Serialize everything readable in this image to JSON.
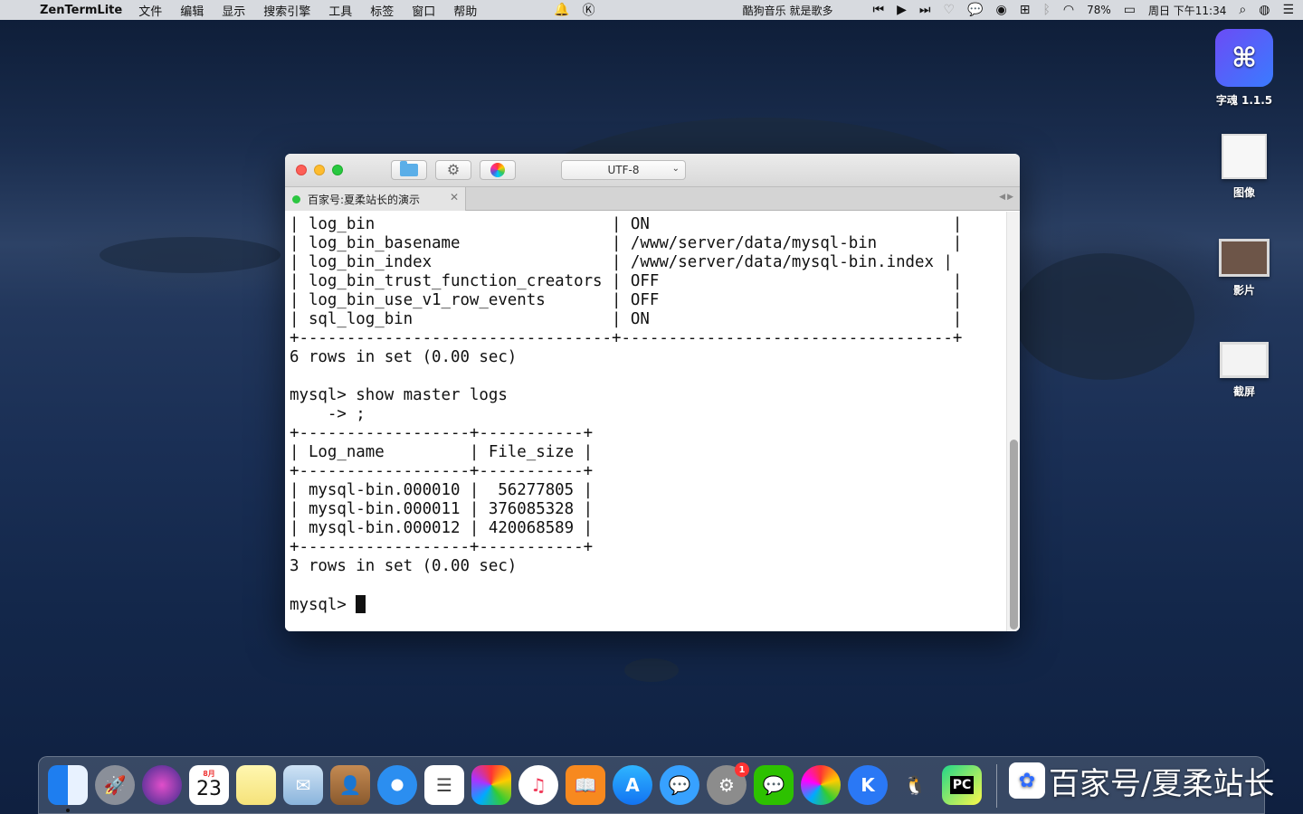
{
  "menubar": {
    "app_name": "ZenTermLite",
    "items": [
      "文件",
      "编辑",
      "显示",
      "搜索引擎",
      "工具",
      "标签",
      "窗口",
      "帮助"
    ],
    "song": "酷狗音乐  就是歌多",
    "battery": "78%",
    "datetime": "周日 下午11:34"
  },
  "window": {
    "encoding": "UTF-8",
    "tab_title": "百家号:夏柔站长的演示",
    "terminal_lines": [
      "| log_bin                         | ON                                |",
      "| log_bin_basename                | /www/server/data/mysql-bin        |",
      "| log_bin_index                   | /www/server/data/mysql-bin.index |",
      "| log_bin_trust_function_creators | OFF                               |",
      "| log_bin_use_v1_row_events       | OFF                               |",
      "| sql_log_bin                     | ON                                |",
      "+---------------------------------+-----------------------------------+",
      "6 rows in set (0.00 sec)",
      "",
      "mysql> show master logs",
      "    -> ;",
      "+------------------+-----------+",
      "| Log_name         | File_size |",
      "+------------------+-----------+",
      "| mysql-bin.000010 |  56277805 |",
      "| mysql-bin.000011 | 376085328 |",
      "| mysql-bin.000012 | 420068589 |",
      "+------------------+-----------+",
      "3 rows in set (0.00 sec)",
      "",
      "mysql> "
    ]
  },
  "desktop": {
    "icons": [
      {
        "label": "字魂 1.1.5",
        "icon": "zihun-app-icon"
      },
      {
        "label": "图像",
        "icon": "photo-icon"
      },
      {
        "label": "影片",
        "icon": "movie-icon"
      },
      {
        "label": "截屏",
        "icon": "screenshot-icon"
      }
    ]
  },
  "dock": {
    "calendar_month": "8月",
    "calendar_day": "23",
    "settings_badge": "1",
    "pycharm_label": "PC",
    "watermark": "百家号/夏柔站长"
  },
  "colors": {
    "accent_green": "#2bc640",
    "traffic_red": "#fd5f57",
    "traffic_yellow": "#febc2e",
    "traffic_green": "#28c840"
  }
}
